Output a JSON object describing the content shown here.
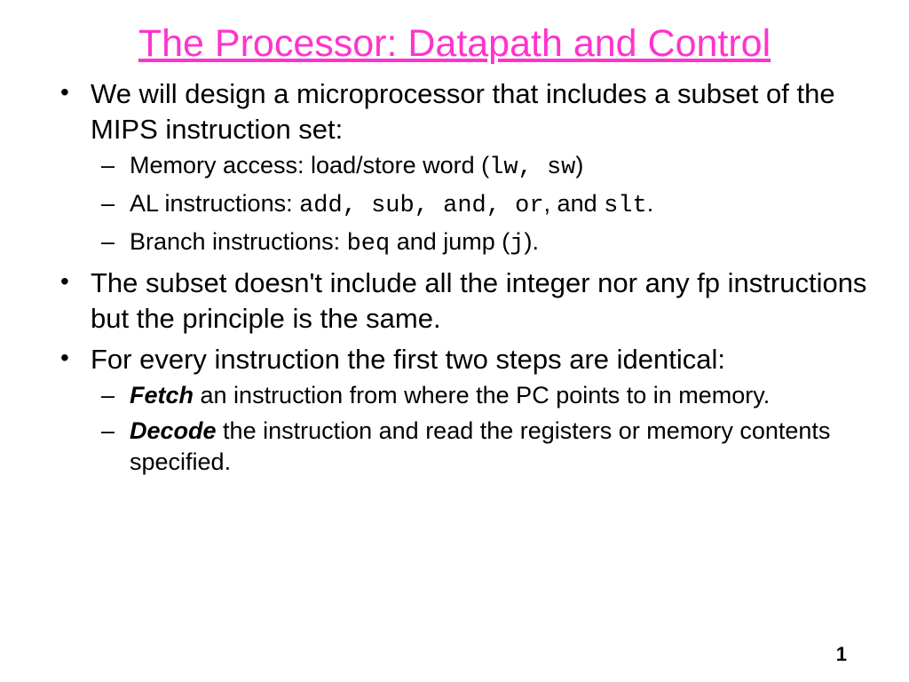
{
  "title": "The Processor: Datapath and Control",
  "bullets": {
    "b1": "We will design a microprocessor that includes a subset of the MIPS instruction set:",
    "b1a_pre": "Memory access: load/store word (",
    "b1a_code": "lw, sw",
    "b1a_post": ")",
    "b1b_pre": "AL instructions: ",
    "b1b_code1": "add, sub, and, or",
    "b1b_mid": ", and ",
    "b1b_code2": "slt",
    "b1b_post": ".",
    "b1c_pre": "Branch instructions: ",
    "b1c_code1": "beq",
    "b1c_mid": " and jump (",
    "b1c_code2": "j",
    "b1c_post": ").",
    "b2": "The subset doesn't include all the integer nor any fp instructions but the principle is the same.",
    "b3": "For every instruction the first two steps are identical:",
    "b3a_bold": "Fetch",
    "b3a_rest": " an instruction from where the PC points to in memory.",
    "b3b_bold": "Decode",
    "b3b_rest": " the instruction and read the registers or memory contents specified."
  },
  "page_number": "1"
}
